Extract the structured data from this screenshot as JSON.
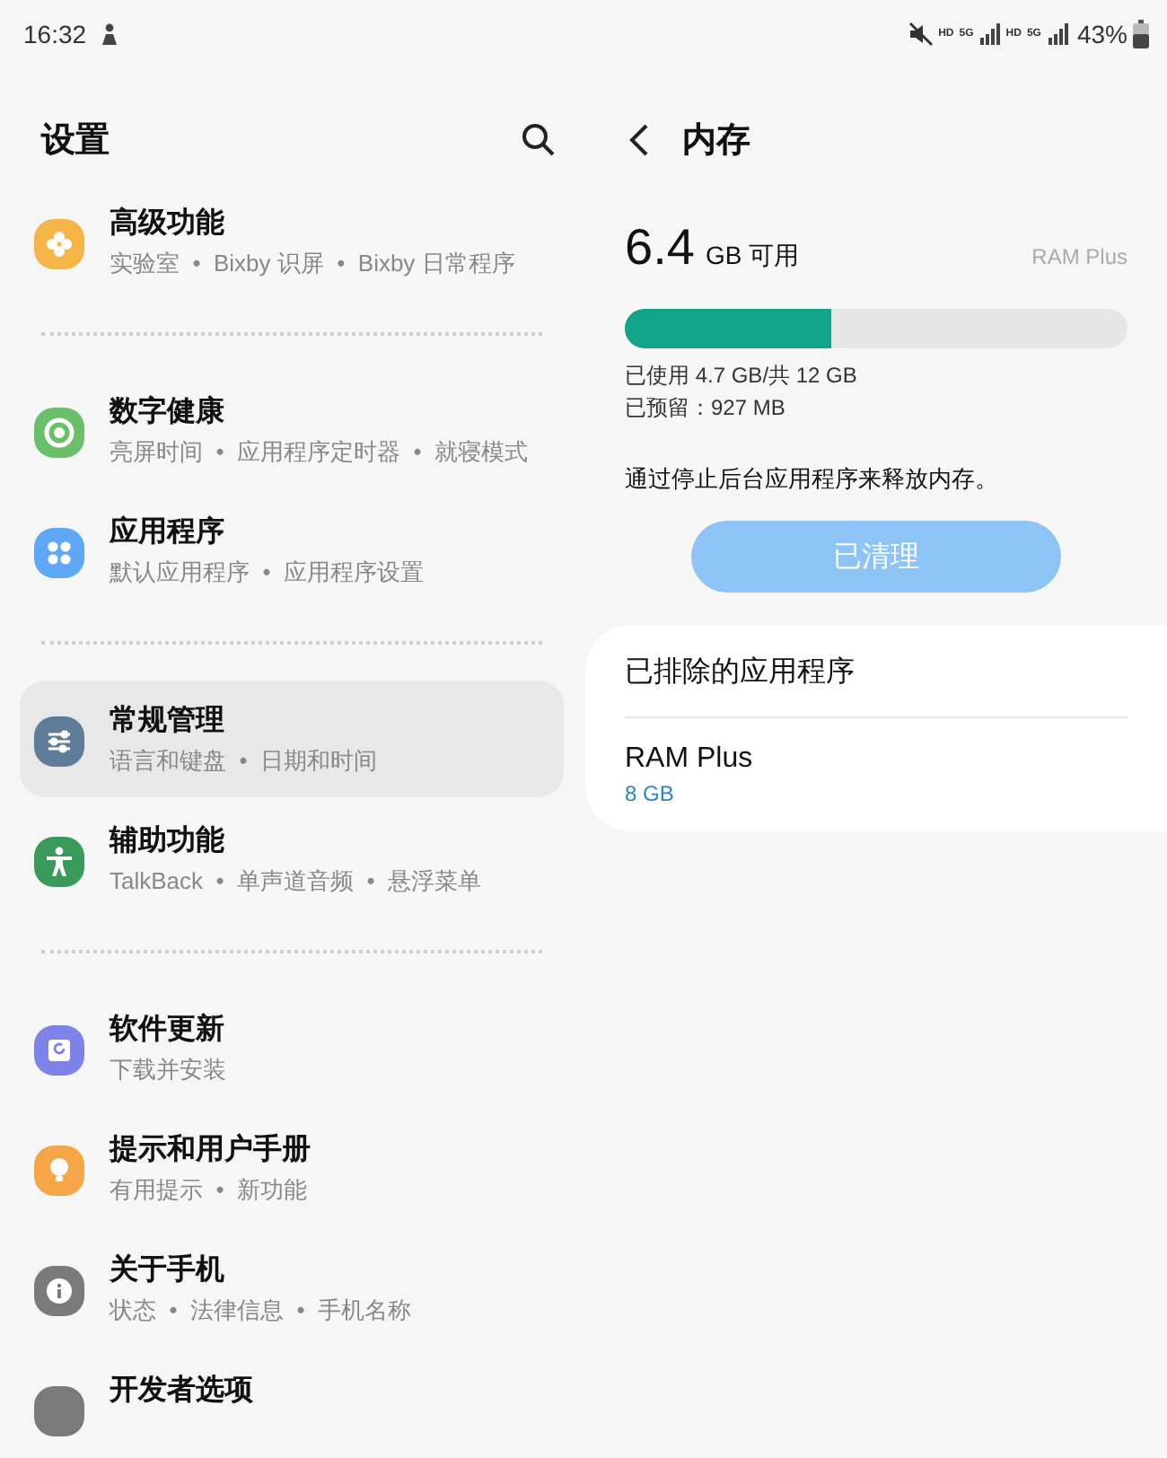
{
  "status_bar": {
    "time": "16:32",
    "network_labels": [
      "HD",
      "5G",
      "HD",
      "5G"
    ],
    "battery": "43%"
  },
  "settings": {
    "title": "设置",
    "groups": [
      {
        "items": [
          {
            "kind": "flower",
            "color": "#f5b546",
            "title": "高级功能",
            "subtitle": "实验室  •  Bixby 识屏  •  Bixby 日常程序",
            "selected": false
          }
        ]
      },
      {
        "items": [
          {
            "kind": "ring",
            "color": "#6cbf6a",
            "title": "数字健康",
            "subtitle": "亮屏时间  •  应用程序定时器  •  就寝模式",
            "selected": false
          },
          {
            "kind": "dots",
            "color": "#5ea8f5",
            "title": "应用程序",
            "subtitle": "默认应用程序  •  应用程序设置",
            "selected": false
          }
        ]
      },
      {
        "items": [
          {
            "kind": "sliders",
            "color": "#5f7d98",
            "title": "常规管理",
            "subtitle": "语言和键盘  •  日期和时间",
            "selected": true
          },
          {
            "kind": "person",
            "color": "#3a9a5c",
            "title": "辅助功能",
            "subtitle": "TalkBack  •  单声道音频  •  悬浮菜单",
            "selected": false
          }
        ]
      },
      {
        "items": [
          {
            "kind": "refresh",
            "color": "#7d83e8",
            "title": "软件更新",
            "subtitle": "下载并安装",
            "selected": false
          },
          {
            "kind": "bulb",
            "color": "#f5a646",
            "title": "提示和用户手册",
            "subtitle": "有用提示  •  新功能",
            "selected": false
          },
          {
            "kind": "info",
            "color": "#7a7a7a",
            "title": "关于手机",
            "subtitle": "状态  •  法律信息  •  手机名称",
            "selected": false
          },
          {
            "kind": "blank",
            "color": "#7a7a7a",
            "title": "开发者选项",
            "selected": false
          }
        ]
      }
    ]
  },
  "memory": {
    "title": "内存",
    "available_value": "6.4",
    "available_unit": "GB 可用",
    "ram_plus_link": "RAM Plus",
    "level": 0.41,
    "used": "已使用 4.7 GB/共 12 GB",
    "reserved": "已预留：927 MB",
    "description": "通过停止后台应用程序来释放内存。",
    "clean_button": {
      "label": "已清理",
      "disabled": true
    },
    "excluded": {
      "title": "已排除的应用程序",
      "items": [
        {
          "name": "RAM Plus",
          "value": "8 GB"
        }
      ]
    }
  }
}
